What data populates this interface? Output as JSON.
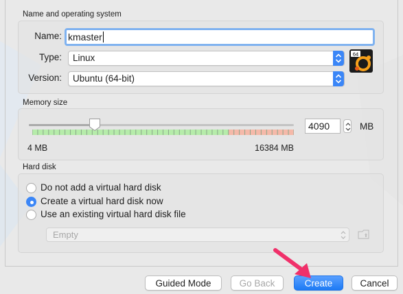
{
  "sections": {
    "name_os": "Name and operating system",
    "memory": "Memory size",
    "hard_disk": "Hard disk"
  },
  "form": {
    "name_label": "Name:",
    "name_value": "kmaster",
    "type_label": "Type:",
    "type_value": "Linux",
    "version_label": "Version:",
    "version_value": "Ubuntu (64-bit)",
    "os_icon_badge": "64"
  },
  "memory": {
    "value": "4090",
    "unit": "MB",
    "min_label": "4 MB",
    "max_label": "16384 MB",
    "min_mb": 4,
    "max_mb": 16384,
    "current_mb": 4090,
    "recommended_limit_fraction": 0.75
  },
  "hard_disk": {
    "options": [
      {
        "label": "Do not add a virtual hard disk",
        "selected": false
      },
      {
        "label": "Create a virtual hard disk now",
        "selected": true
      },
      {
        "label": "Use an existing virtual hard disk file",
        "selected": false
      }
    ],
    "file_select_value": "Empty"
  },
  "buttons": {
    "guided_mode": "Guided Mode",
    "go_back": "Go Back",
    "create": "Create",
    "cancel": "Cancel"
  },
  "colors": {
    "accent": "#3b86f7",
    "annotation_arrow": "#f0306a",
    "scale_ok": "#b6ecaa",
    "scale_bad": "#f5b9a9"
  }
}
